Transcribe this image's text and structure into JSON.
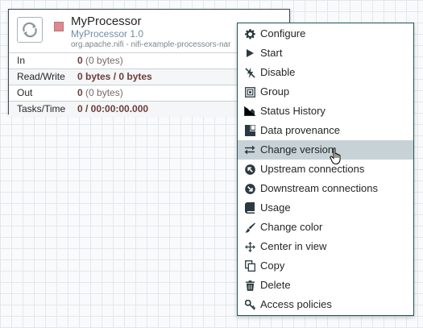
{
  "processor": {
    "name": "MyProcessor",
    "type": "MyProcessor 1.0",
    "bundle": "org.apache.nifi - nifi-example-processors-nar",
    "state": "stopped",
    "stats": [
      {
        "label": "In",
        "value": "0",
        "extra": "(0 bytes)"
      },
      {
        "label": "Read/Write",
        "value": "0 bytes / 0 bytes",
        "extra": ""
      },
      {
        "label": "Out",
        "value": "0",
        "extra": "(0 bytes)"
      },
      {
        "label": "Tasks/Time",
        "value": "0 / 00:00:00.000",
        "extra": ""
      }
    ]
  },
  "context_menu": {
    "items": [
      {
        "label": "Configure",
        "icon": "gear-icon"
      },
      {
        "label": "Start",
        "icon": "play-icon"
      },
      {
        "label": "Disable",
        "icon": "disable-icon"
      },
      {
        "label": "Group",
        "icon": "group-icon"
      },
      {
        "label": "Status History",
        "icon": "area-chart-icon"
      },
      {
        "label": "Data provenance",
        "icon": "provenance-icon"
      },
      {
        "label": "Change version",
        "icon": "swap-icon"
      },
      {
        "label": "Upstream connections",
        "icon": "upstream-icon"
      },
      {
        "label": "Downstream connections",
        "icon": "downstream-icon"
      },
      {
        "label": "Usage",
        "icon": "book-icon"
      },
      {
        "label": "Change color",
        "icon": "paintbrush-icon"
      },
      {
        "label": "Center in view",
        "icon": "crosshair-icon"
      },
      {
        "label": "Copy",
        "icon": "copy-icon"
      },
      {
        "label": "Delete",
        "icon": "trash-icon"
      },
      {
        "label": "Access policies",
        "icon": "key-icon"
      }
    ],
    "hovered_item": "Change version"
  },
  "colors": {
    "menu_hover": "#c7d2d7",
    "icon": "#2b3a40",
    "stat_value": "#6b3d3a",
    "processor_type": "#6f8ea3",
    "stopped_state": "#d98b92"
  }
}
